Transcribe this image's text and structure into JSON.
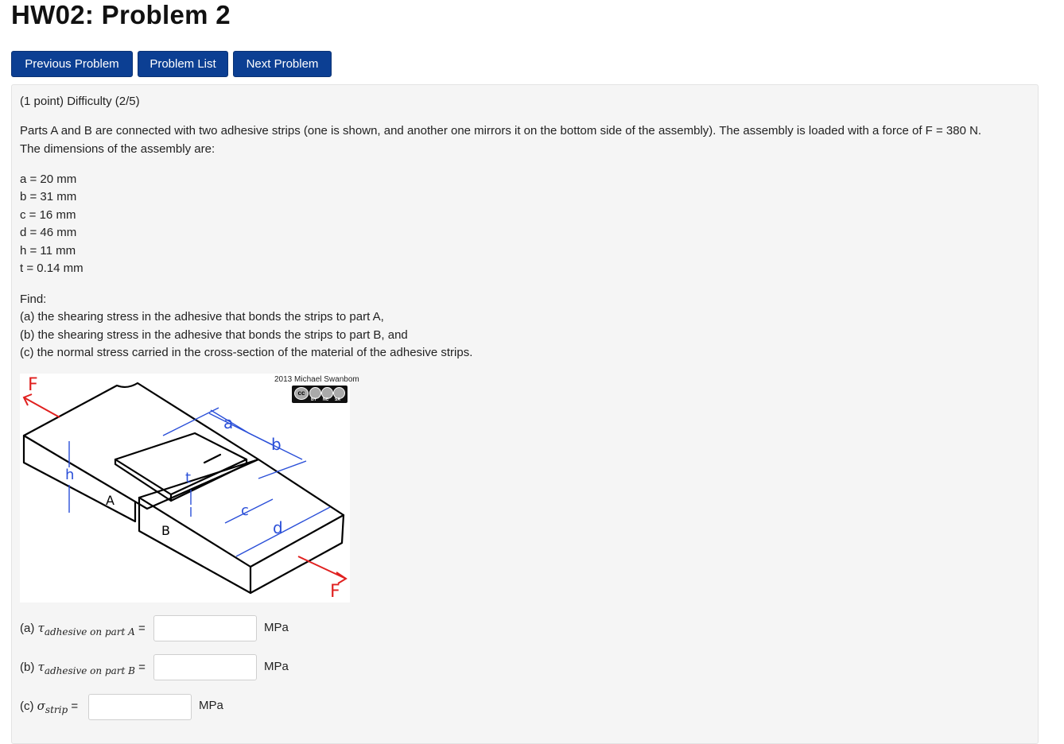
{
  "page": {
    "title": "HW02: Problem 2"
  },
  "nav": {
    "previous_label": "Previous Problem",
    "list_label": "Problem List",
    "next_label": "Next Problem"
  },
  "problem": {
    "header": "(1 point) Difficulty (2/5)",
    "intro_line1": "Parts A and B are connected with two adhesive strips (one is shown, and another one mirrors it on the bottom side of the assembly). The assembly is loaded with a force of F = 380 N.",
    "intro_line2": "The dimensions of the assembly are:",
    "dimensions": [
      "a = 20 mm",
      "b = 31 mm",
      "c = 16 mm",
      "d = 46 mm",
      "h = 11 mm",
      "t = 0.14 mm"
    ],
    "find_label": "Find:",
    "find_items": [
      "(a) the shearing stress in the adhesive that bonds the strips to part A,",
      "(b) the shearing stress in the adhesive that bonds the strips to part B, and",
      "(c) the normal stress carried in the cross-section of the material of the adhesive strips."
    ]
  },
  "figure": {
    "credit": "2013 Michael Swanbom",
    "license_badges": [
      "cc",
      "BY",
      "NC",
      "SA"
    ],
    "labels": {
      "F_left": "F",
      "F_right": "F",
      "a": "a",
      "b": "b",
      "c": "c",
      "d": "d",
      "h": "h",
      "t": "t",
      "A": "A",
      "B": "B"
    },
    "colors": {
      "force": "#e0201f",
      "dimension": "#2a4fd8",
      "outline": "#000000"
    }
  },
  "answers": [
    {
      "prefix": "(a) ",
      "symbol": "τ",
      "subscript": "adhesive on part A",
      "equals": " =",
      "value": "",
      "unit": "MPa"
    },
    {
      "prefix": "(b) ",
      "symbol": "τ",
      "subscript": "adhesive on part B",
      "equals": " =",
      "value": "",
      "unit": "MPa"
    },
    {
      "prefix": "(c) ",
      "symbol": "σ",
      "subscript": "strip",
      "equals": " =",
      "value": "",
      "unit": "MPa"
    }
  ]
}
